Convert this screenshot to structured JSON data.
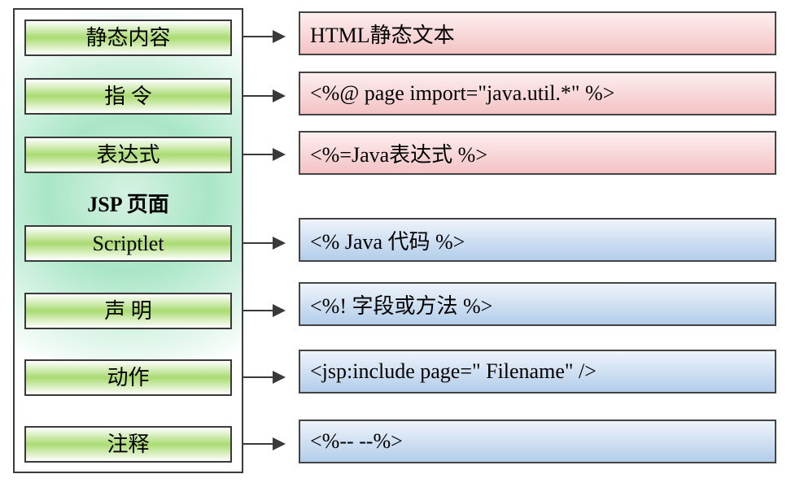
{
  "panel": {
    "title": "JSP 页面",
    "items": [
      "静态内容",
      "指 令",
      "表达式",
      "Scriptlet",
      "声 明",
      "动作",
      "注释"
    ]
  },
  "right": [
    "HTML静态文本",
    "<%@ page import=\"java.util.*\" %>",
    "<%=Java表达式 %>",
    "<% Java 代码 %>",
    "<%! 字段或方法 %>",
    "<jsp:include page=\" Filename\" />",
    "<%-- --%>"
  ],
  "chart_data": {
    "type": "table",
    "title": "JSP 页面",
    "rows": [
      {
        "element": "静态内容",
        "example": "HTML静态文本"
      },
      {
        "element": "指 令",
        "example": "<%@ page import=\"java.util.*\" %>"
      },
      {
        "element": "表达式",
        "example": "<%=Java表达式 %>"
      },
      {
        "element": "Scriptlet",
        "example": "<% Java 代码 %>"
      },
      {
        "element": "声 明",
        "example": "<%! 字段或方法 %>"
      },
      {
        "element": "动作",
        "example": "<jsp:include page=\" Filename\" />"
      },
      {
        "element": "注释",
        "example": "<%-- --%>"
      }
    ]
  }
}
